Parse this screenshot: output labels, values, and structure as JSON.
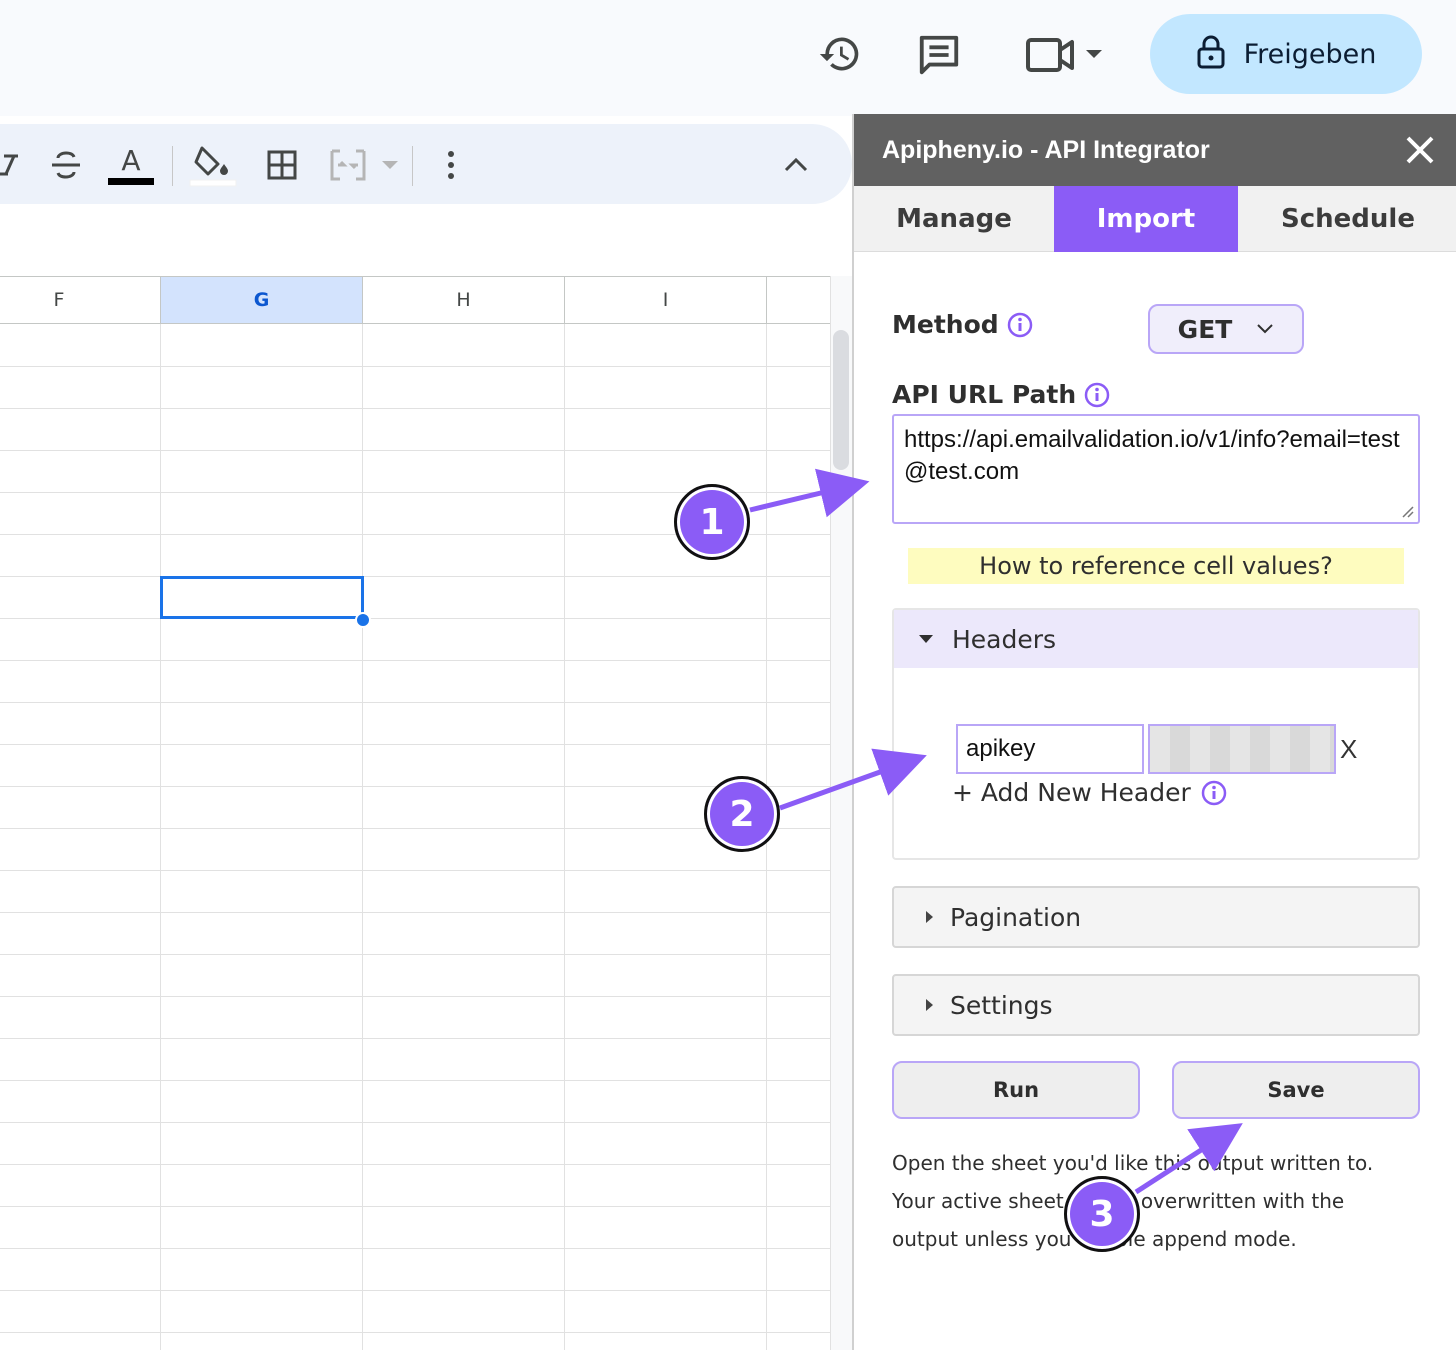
{
  "topbar": {
    "share_label": "Freigeben",
    "icons": [
      "history-icon",
      "comment-icon",
      "video-call-icon",
      "lock-icon"
    ]
  },
  "toolbar": {
    "icons": [
      "italic-icon",
      "strikethrough-icon",
      "text-color-icon",
      "fill-color-icon",
      "borders-icon",
      "merge-cells-icon",
      "more-options-icon",
      "collapse-toolbar-icon"
    ]
  },
  "grid": {
    "columns": [
      "F",
      "G",
      "H",
      "I"
    ],
    "selected_column": "G"
  },
  "sidebar": {
    "title": "Apipheny.io - API Integrator",
    "tabs": [
      "Manage",
      "Import",
      "Schedule"
    ],
    "active_tab": "Import",
    "method_label": "Method",
    "method_value": "GET",
    "url_label": "API URL Path",
    "url_value": "https://api.emailvalidation.io/v1/info?email=test@test.com",
    "hint": "How to reference cell values?",
    "headers_label": "Headers",
    "header_key": "apikey",
    "header_remove": "X",
    "add_header": "+ Add New Header",
    "pagination_label": "Pagination",
    "settings_label": "Settings",
    "run_label": "Run",
    "save_label": "Save",
    "note": "Open the sheet you'd like this output written to. Your active sheet will be overwritten with the output unless you enable append mode."
  },
  "annotations": {
    "badges": [
      "1",
      "2",
      "3"
    ],
    "accent_color": "#8b5cf6"
  }
}
